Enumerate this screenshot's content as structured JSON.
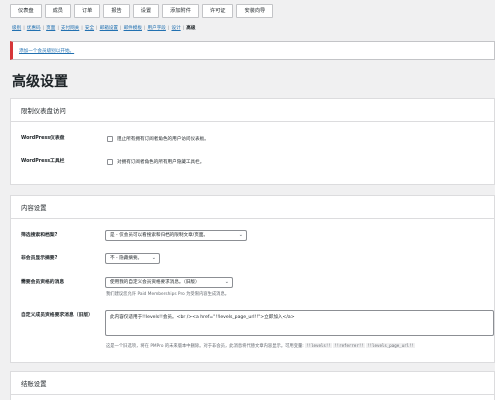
{
  "topnav": {
    "tabs": [
      "仪表盘",
      "成员",
      "订单",
      "报告",
      "设置",
      "添加附件",
      "许可证",
      "安装向导"
    ]
  },
  "subnav": {
    "items": [
      {
        "label": "级别",
        "current": false
      },
      {
        "label": "优惠码",
        "current": false
      },
      {
        "label": "页面",
        "current": false
      },
      {
        "label": "支付网关",
        "current": false
      },
      {
        "label": "安全",
        "current": false
      },
      {
        "label": "邮箱设置",
        "current": false
      },
      {
        "label": "邮件模板",
        "current": false
      },
      {
        "label": "用户字段",
        "current": false
      },
      {
        "label": "设计",
        "current": false
      },
      {
        "label": "高级",
        "current": true
      }
    ]
  },
  "notice": {
    "link": "添加一个会员级别以开始。",
    "accent_color": "#d63638"
  },
  "page": {
    "title": "高级设置"
  },
  "dashboard_panel": {
    "heading": "限制仪表盘访问",
    "rows": [
      {
        "label": "WordPress仪表盘",
        "checkbox_text": "阻止所有拥有订阅者角色的用户访问仪表板。",
        "checked": false
      },
      {
        "label": "WordPress工具栏",
        "checkbox_text": "对拥有订阅者角色的所有用户隐藏工具栏。",
        "checked": false
      }
    ]
  },
  "content_panel": {
    "heading": "内容设置",
    "filter_searches": {
      "label": "筛选搜索和档案?",
      "value": "是 - 仅会员可以看搜索和归档的限制文章/页面。"
    },
    "show_excerpts": {
      "label": "非会员显示摘要?",
      "value": "不 - 隐藏摘要。"
    },
    "require_message": {
      "label": "需要会员资格的消息",
      "value": "使用我的自定义会员资格要求消息。（旧版）",
      "help": "我们建议您允许 Paid Memberships Pro 为受限内容生成消息。"
    },
    "custom_message": {
      "label": "自定义成员资格要求消息（旧版）",
      "value": "此内容仅适用于!!levels!!会员。<br /><a href=\"!!levels_page_url!!\">立即加入</a>",
      "help_prefix": "这是一个旧选项，将在 PMPro 的未来版本中删除。对于非会员，此消息将代替文章内容显示。可用变量:",
      "variables": [
        "!!levels!!",
        "!!referrer!!",
        "!!levels_page_url!!"
      ]
    }
  },
  "checkout_panel": {
    "heading": "结账设置"
  }
}
